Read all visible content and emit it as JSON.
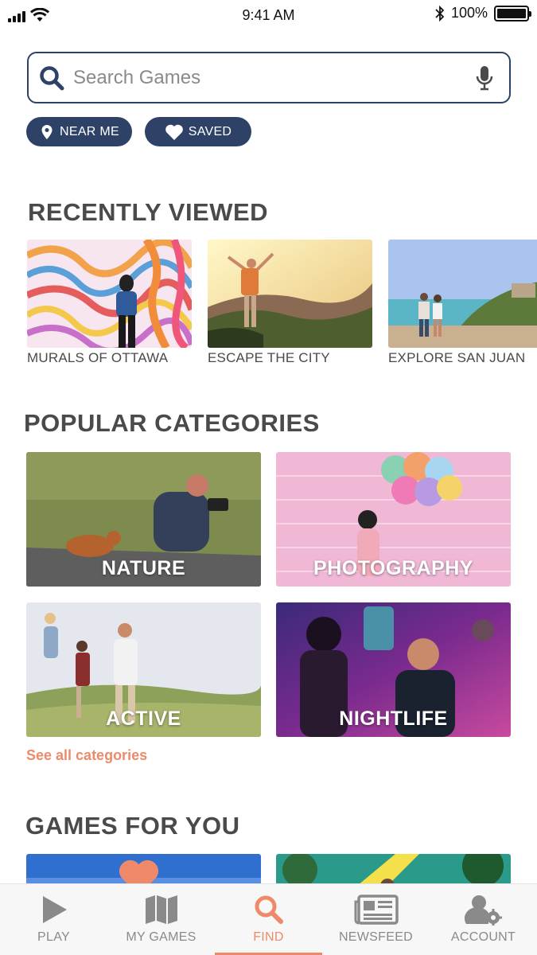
{
  "status_bar": {
    "time": "9:41 AM",
    "battery": "100%"
  },
  "search": {
    "placeholder": "Search Games"
  },
  "filters": {
    "near_me": "NEAR ME",
    "saved": "SAVED"
  },
  "recently_viewed": {
    "title": "RECENTLY VIEWED",
    "items": [
      {
        "label": "MURALS OF OTTAWA"
      },
      {
        "label": "ESCAPE THE CITY"
      },
      {
        "label": "EXPLORE SAN JUAN"
      }
    ]
  },
  "popular_categories": {
    "title": "POPULAR CATEGORIES",
    "items": [
      {
        "label": "NATURE"
      },
      {
        "label": "PHOTOGRAPHY"
      },
      {
        "label": "ACTIVE"
      },
      {
        "label": "NIGHTLIFE"
      }
    ],
    "see_all": "See all categories"
  },
  "games_for_you": {
    "title": "GAMES FOR YOU"
  },
  "tabs": [
    {
      "label": "PLAY",
      "icon": "play-icon"
    },
    {
      "label": "MY GAMES",
      "icon": "map-icon"
    },
    {
      "label": "FIND",
      "icon": "search-icon",
      "active": true
    },
    {
      "label": "NEWSFEED",
      "icon": "newspaper-icon"
    },
    {
      "label": "ACCOUNT",
      "icon": "account-gear-icon"
    }
  ],
  "colors": {
    "navy": "#2e4268",
    "accent": "#ee8a6a",
    "text": "#4a4a4a"
  }
}
